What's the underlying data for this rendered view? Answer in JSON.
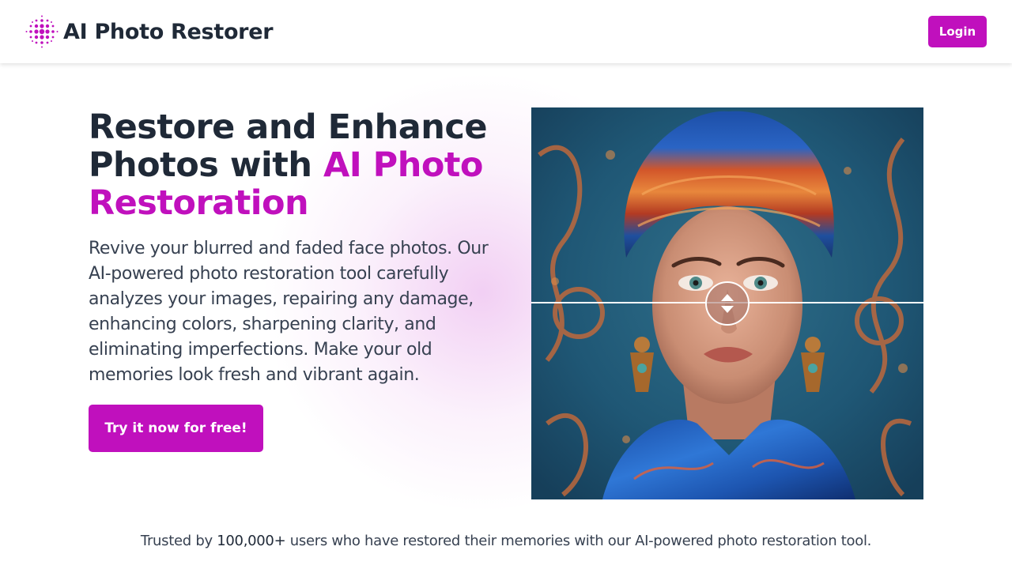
{
  "header": {
    "brand": "AI Photo Restorer",
    "logo_icon": "dotted-circle-logo-icon",
    "login_label": "Login"
  },
  "hero": {
    "title_line1": "Restore and Enhance",
    "title_line2_plain": "Photos with ",
    "title_line2_accent": "AI Photo",
    "title_line3_accent": "Restoration",
    "description": "Revive your blurred and faded face photos. Our AI-powered photo restoration tool carefully analyzes your images, repairing any damage, enhancing colors, sharpening clarity, and eliminating imperfections. Make your old memories look fresh and vibrant again.",
    "cta_label": "Try it now for free!"
  },
  "compare": {
    "slider_icon": "up-down-arrows-icon",
    "slider_position": 0.5
  },
  "trusted": {
    "prefix": "Trusted by ",
    "count": "100,000+",
    "suffix": " users who have restored their memories with our AI-powered photo restoration tool."
  },
  "colors": {
    "accent": "#c010bd",
    "text_dark": "#1f2937"
  }
}
